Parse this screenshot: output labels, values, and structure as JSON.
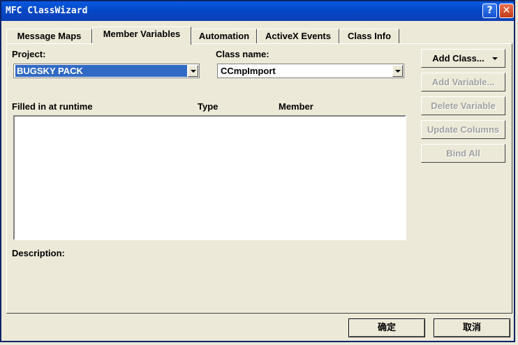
{
  "window": {
    "title": "MFC ClassWizard",
    "help_glyph": "?",
    "close_glyph": "✕"
  },
  "tabs": [
    {
      "label": "Message Maps",
      "active": false
    },
    {
      "label": "Member Variables",
      "active": true
    },
    {
      "label": "Automation",
      "active": false
    },
    {
      "label": "ActiveX Events",
      "active": false
    },
    {
      "label": "Class Info",
      "active": false
    }
  ],
  "project": {
    "label": "Project:",
    "value": "BUGSKY PACK"
  },
  "class_name": {
    "label": "Class name:",
    "value": "CCmpImport"
  },
  "list": {
    "columns": [
      "Filled in at runtime",
      "Type",
      "Member"
    ],
    "rows": []
  },
  "description": {
    "label": "Description:"
  },
  "buttons": {
    "add_class": "Add Class...",
    "add_variable": "Add Variable...",
    "delete_variable": "Delete Variable",
    "update_columns": "Update Columns",
    "bind_all": "Bind All"
  },
  "dialog_buttons": {
    "ok": "确定",
    "cancel": "取消"
  }
}
